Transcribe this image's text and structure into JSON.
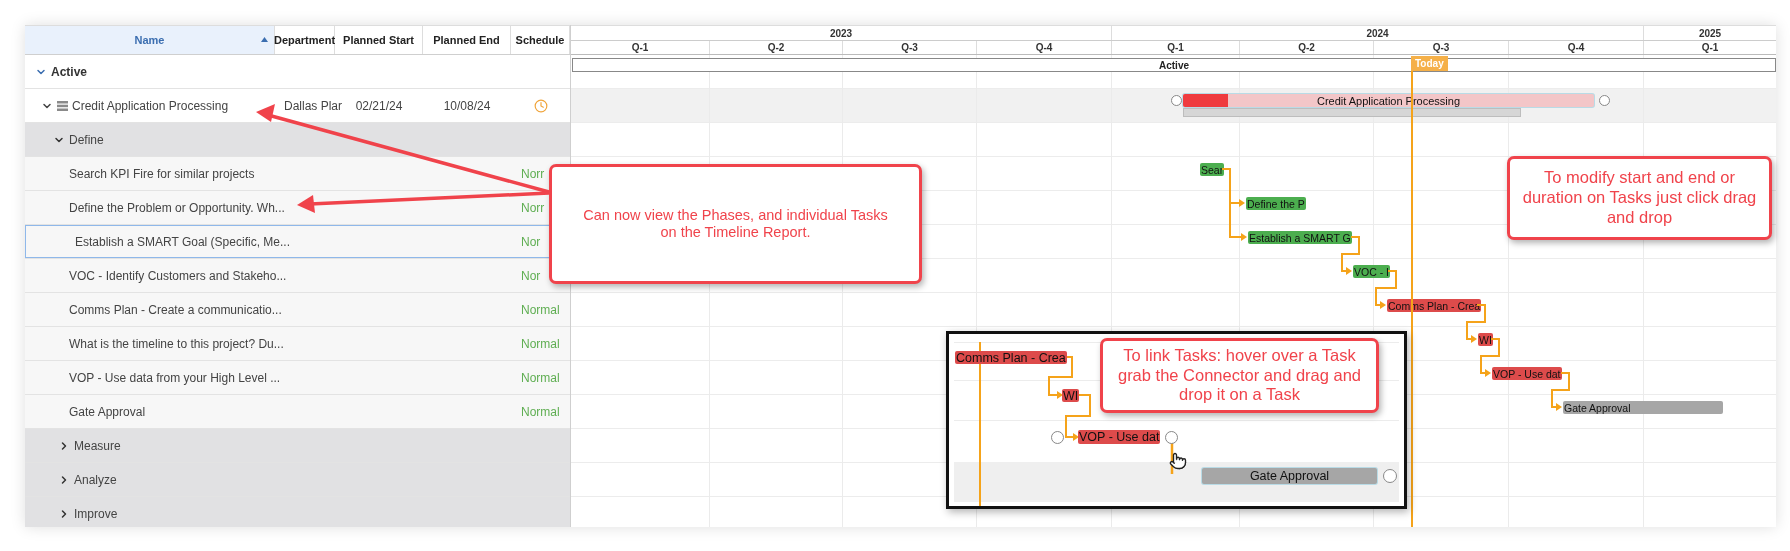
{
  "grid": {
    "columns": [
      {
        "label": "Name",
        "sorted": true
      },
      {
        "label": "Department",
        "sorted": false
      },
      {
        "label": "Planned Start",
        "sorted": false
      },
      {
        "label": "Planned End",
        "sorted": false
      },
      {
        "label": "Schedule",
        "sorted": false
      }
    ],
    "rows": [
      {
        "kind": "group",
        "name": "Active",
        "expanded": true
      },
      {
        "kind": "project",
        "name": "Credit Application Processing",
        "expanded": true,
        "department": "Dallas Plar",
        "planned_start": "02/21/24",
        "planned_end": "10/08/24"
      },
      {
        "kind": "phase",
        "name": "Define",
        "expanded": true
      },
      {
        "kind": "task",
        "name": "Search KPI Fire for similar projects",
        "schedule": "Norr",
        "selected": false
      },
      {
        "kind": "task",
        "name": "Define the Problem or Opportunity. Wh...",
        "schedule": "Norr",
        "selected": false
      },
      {
        "kind": "task",
        "name": "Establish a SMART Goal (Specific, Me...",
        "schedule": "Nor",
        "selected": true
      },
      {
        "kind": "task",
        "name": "VOC - Identify Customers and Stakeho...",
        "schedule": "Nor",
        "selected": false
      },
      {
        "kind": "task",
        "name": "Comms Plan - Create a communicatio...",
        "schedule": "Normal",
        "selected": false
      },
      {
        "kind": "task",
        "name": "What is the timeline to this project? Du...",
        "schedule": "Normal",
        "selected": false
      },
      {
        "kind": "task",
        "name": "VOP - Use data from your High Level ...",
        "schedule": "Normal",
        "selected": false
      },
      {
        "kind": "task",
        "name": "Gate Approval",
        "schedule": "Normal",
        "selected": false
      },
      {
        "kind": "phase",
        "name": "Measure",
        "expanded": false
      },
      {
        "kind": "phase",
        "name": "Analyze",
        "expanded": false
      },
      {
        "kind": "phase",
        "name": "Improve",
        "expanded": false
      }
    ]
  },
  "timeline": {
    "years": [
      {
        "label": "2023",
        "quarters": [
          "Q-1",
          "Q-2",
          "Q-3",
          "Q-4"
        ]
      },
      {
        "label": "2024",
        "quarters": [
          "Q-1",
          "Q-2",
          "Q-3",
          "Q-4"
        ]
      },
      {
        "label": "2025",
        "quarters": [
          "Q-1"
        ]
      }
    ],
    "summary_bar": {
      "label": "Active"
    },
    "today": {
      "label": "Today"
    },
    "bars": [
      {
        "label": "Credit Application Processing",
        "color": "#f3c6c8",
        "level": 0.11
      },
      {
        "label": "Sear",
        "color": "#4cae4f"
      },
      {
        "label": "Define the P",
        "color": "#4cae4f"
      },
      {
        "label": "Establish a SMART G",
        "color": "#4cae4f"
      },
      {
        "label": "VOC - I",
        "color": "#4cae4f"
      },
      {
        "label": "Comms Plan - Crea",
        "color": "#dd4b4b"
      },
      {
        "label": "WI",
        "color": "#dd4b4b"
      },
      {
        "label": "VOP - Use dat",
        "color": "#dd4b4b"
      },
      {
        "label": "Gate Approval",
        "color": "#a6a6a6"
      }
    ]
  },
  "inset": {
    "bars": [
      {
        "label": "Comms Plan - Crea",
        "color": "#dd4b4b"
      },
      {
        "label": "WI",
        "color": "#dd4b4b"
      },
      {
        "label": "VOP - Use dat",
        "color": "#dd4b4b"
      },
      {
        "label": "Gate Approval",
        "color": "#a6a6a6"
      }
    ]
  },
  "callouts": [
    {
      "text": "Can now view the Phases, and individual Tasks on the Timeline Report."
    },
    {
      "text": "To modify start and end or duration on Tasks just click drag and drop"
    },
    {
      "text": "To link Tasks: hover over a Task grab the Connector and drag and drop it on a Task"
    }
  ]
}
